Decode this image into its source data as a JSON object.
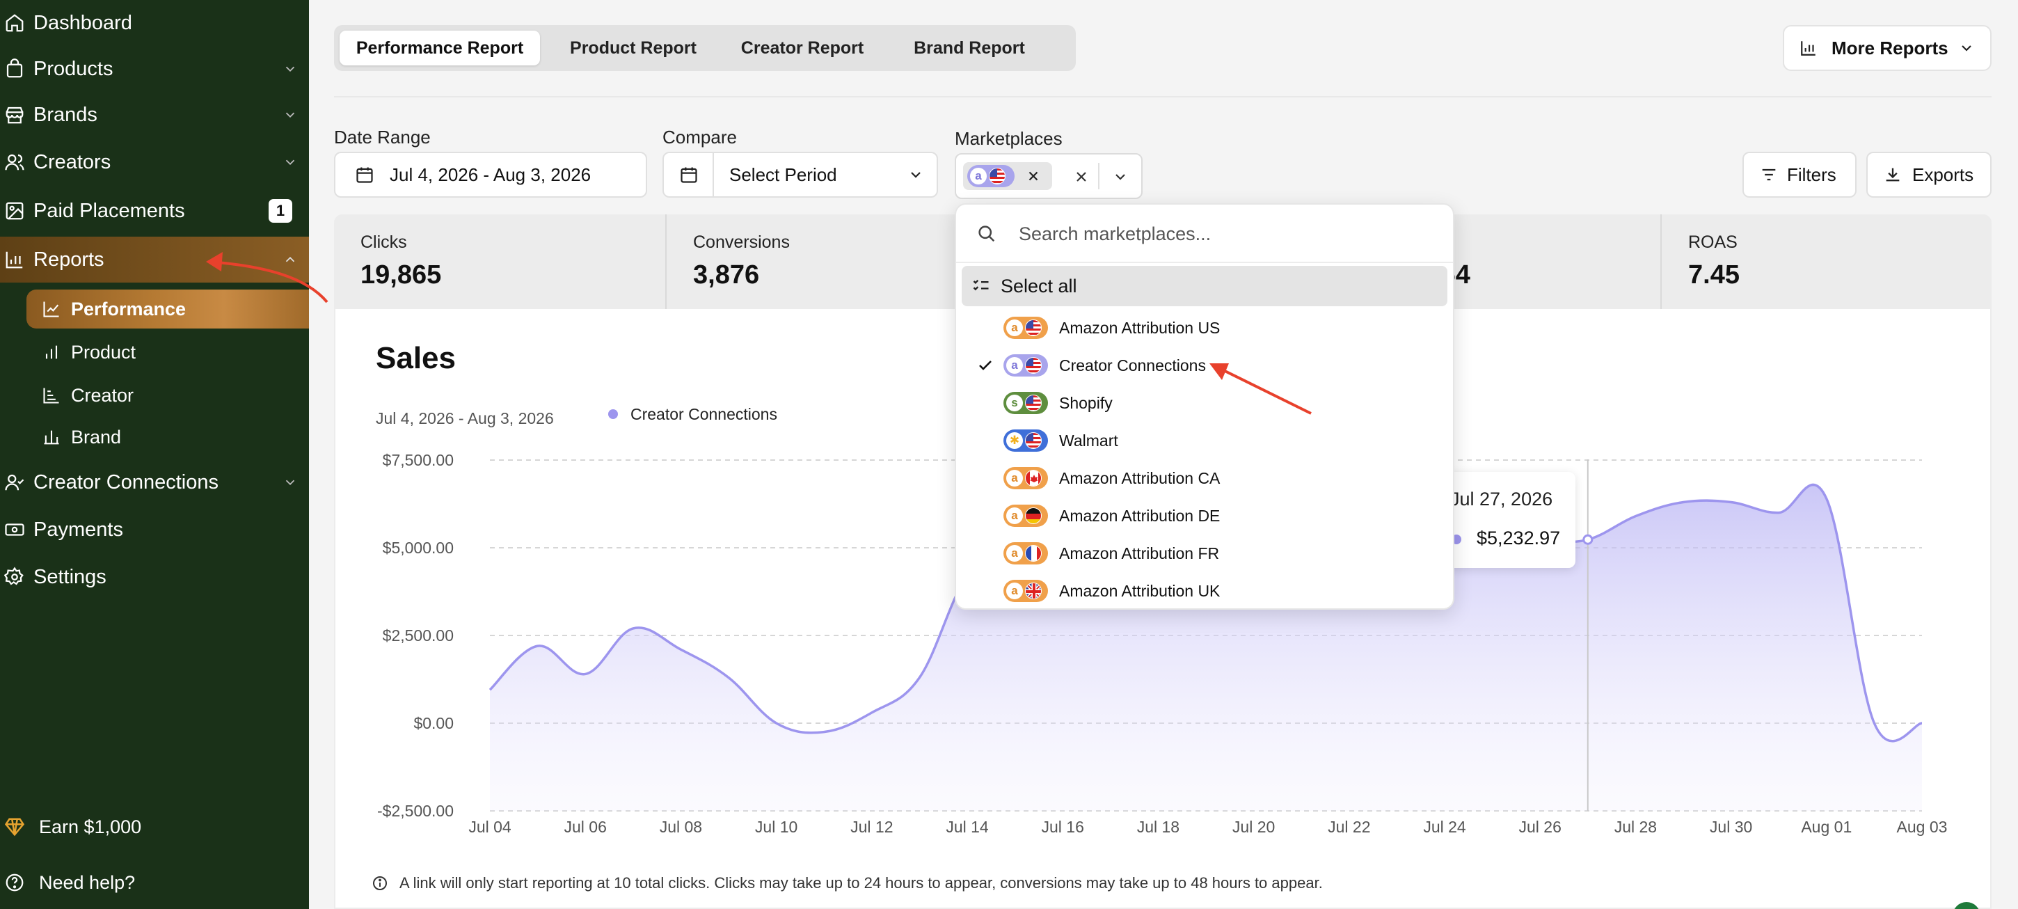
{
  "sidebar": {
    "items": [
      {
        "label": "Dashboard",
        "icon": "home-icon",
        "has_chevron": false
      },
      {
        "label": "Products",
        "icon": "bag-icon",
        "has_chevron": true
      },
      {
        "label": "Brands",
        "icon": "store-icon",
        "has_chevron": true
      },
      {
        "label": "Creators",
        "icon": "users-icon",
        "has_chevron": true
      },
      {
        "label": "Paid Placements",
        "icon": "image-icon",
        "badge": "1"
      },
      {
        "label": "Reports",
        "icon": "bar-chart-icon",
        "has_chevron": true,
        "active": true
      },
      {
        "label": "Creator Connections",
        "icon": "user-check-icon",
        "has_chevron": true
      },
      {
        "label": "Payments",
        "icon": "banknote-icon"
      },
      {
        "label": "Settings",
        "icon": "gear-icon"
      }
    ],
    "report_subitems": [
      {
        "label": "Performance",
        "icon": "line-chart-icon",
        "active": true
      },
      {
        "label": "Product",
        "icon": "bar-chart-icon"
      },
      {
        "label": "Creator",
        "icon": "stacked-chart-icon"
      },
      {
        "label": "Brand",
        "icon": "bar-chart-icon"
      }
    ],
    "earn_label": "Earn $1,000",
    "help_label": "Need help?"
  },
  "tabs": [
    "Performance Report",
    "Product Report",
    "Creator Report",
    "Brand Report"
  ],
  "active_tab": "Performance Report",
  "more_reports_label": "More Reports",
  "filters": {
    "date_range_label": "Date Range",
    "date_range_value": "Jul 4, 2026 - Aug 3, 2026",
    "compare_label": "Compare",
    "compare_placeholder": "Select Period",
    "marketplaces_label": "Marketplaces",
    "filters_button": "Filters",
    "exports_button": "Exports"
  },
  "stats": [
    {
      "label": "Clicks",
      "value": "19,865"
    },
    {
      "label": "Conversions",
      "value": "3,876"
    },
    {
      "label": "",
      "value": ".54"
    },
    {
      "label": "ROAS",
      "value": "7.45"
    }
  ],
  "dropdown": {
    "search_placeholder": "Search marketplaces...",
    "select_all_label": "Select all",
    "items": [
      {
        "label": "Amazon Attribution US",
        "logo": "amazon",
        "flag": "us",
        "checked": false
      },
      {
        "label": "Creator Connections",
        "logo": "amazon",
        "flag": "us",
        "checked": true
      },
      {
        "label": "Shopify",
        "logo": "shopify",
        "flag": "us",
        "checked": false
      },
      {
        "label": "Walmart",
        "logo": "walmart",
        "flag": "us",
        "checked": false
      },
      {
        "label": "Amazon Attribution CA",
        "logo": "amazon",
        "flag": "ca",
        "checked": false
      },
      {
        "label": "Amazon Attribution DE",
        "logo": "amazon",
        "flag": "de",
        "checked": false
      },
      {
        "label": "Amazon Attribution FR",
        "logo": "amazon",
        "flag": "fr",
        "checked": false
      },
      {
        "label": "Amazon Attribution UK",
        "logo": "amazon",
        "flag": "uk",
        "checked": false
      }
    ]
  },
  "colors": {
    "sidebar_bg": "#1a3118",
    "active_orange": "#b57a33",
    "series_purple": "#9d95ee",
    "amazon_pill": "#f0a04a",
    "creator_pill": "#a8a4ec",
    "shopify_pill": "#5e8e3e",
    "walmart_pill": "#3f6fd9",
    "annotation_red": "#e8412c"
  },
  "chart_data": {
    "type": "area",
    "title": "Sales",
    "subtitle": "Jul 4, 2026 - Aug 3, 2026",
    "legend": [
      {
        "name": "Creator Connections",
        "color": "#9d95ee"
      }
    ],
    "ylim": [
      -2500,
      7500
    ],
    "y_ticks": [
      "$7,500.00",
      "$5,000.00",
      "$2,500.00",
      "$0.00",
      "-$2,500.00"
    ],
    "y_tick_values": [
      7500,
      5000,
      2500,
      0,
      -2500
    ],
    "x_tick_labels": [
      "Jul 04",
      "Jul 06",
      "Jul 08",
      "Jul 10",
      "Jul 12",
      "Jul 14",
      "Jul 16",
      "Jul 18",
      "Jul 20",
      "Jul 22",
      "Jul 24",
      "Jul 26",
      "Jul 28",
      "Jul 30",
      "Aug 01",
      "Aug 03"
    ],
    "series": [
      {
        "name": "Creator Connections",
        "x": [
          "Jul 04",
          "Jul 05",
          "Jul 06",
          "Jul 07",
          "Jul 08",
          "Jul 09",
          "Jul 10",
          "Jul 11",
          "Jul 12",
          "Jul 13",
          "Jul 14",
          "Jul 15",
          "Jul 16",
          "Jul 17",
          "Jul 18",
          "Jul 19",
          "Jul 20",
          "Jul 21",
          "Jul 22",
          "Jul 23",
          "Jul 24",
          "Jul 25",
          "Jul 26",
          "Jul 27",
          "Jul 28",
          "Jul 29",
          "Jul 30",
          "Jul 31",
          "Aug 01",
          "Aug 02",
          "Aug 03"
        ],
        "values": [
          950,
          2200,
          1400,
          2700,
          2100,
          1300,
          0,
          -250,
          300,
          1300,
          4200,
          5000,
          5200,
          5200,
          5200,
          5200,
          5200,
          5200,
          5200,
          5200,
          5200,
          5200,
          5200,
          5232.97,
          5900,
          6300,
          6300,
          6000,
          6400,
          0,
          0
        ]
      }
    ],
    "tooltip": {
      "date": "Jul 27, 2026",
      "value": "$5,232.97"
    },
    "footnote": "A link will only start reporting at 10 total clicks. Clicks may take up to 24 hours to appear, conversions may take up to 48 hours to appear."
  }
}
